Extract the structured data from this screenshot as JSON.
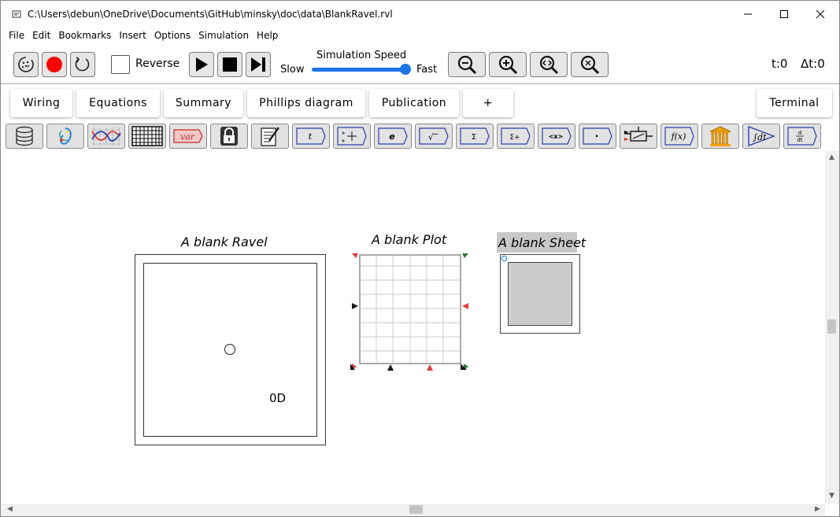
{
  "window": {
    "title": "C:\\Users\\debun\\OneDrive\\Documents\\GitHub\\minsky\\doc\\data\\BlankRavel.rvl",
    "controls": [
      "minimize-icon",
      "maximize-icon",
      "close-icon"
    ]
  },
  "menubar": {
    "items": [
      "File",
      "Edit",
      "Bookmarks",
      "Insert",
      "Options",
      "Simulation",
      "Help"
    ]
  },
  "toolbar": {
    "reverse_label": "Reverse",
    "reverse_checked": false,
    "speed_title": "Simulation Speed",
    "speed_slow": "Slow",
    "speed_fast": "Fast",
    "speed_value": 1.0,
    "t_readout": "t:0",
    "dt_readout": "Δt:0",
    "record_color": "#ff0000",
    "slider_color": "#1a73e8"
  },
  "tabs": [
    "Wiring",
    "Equations",
    "Summary",
    "Phillips diagram",
    "Publication",
    "+",
    "Terminal"
  ],
  "operators": [
    "database-icon",
    "godley-variable-icon",
    "plot-icon",
    "sheet-icon",
    "variable-icon",
    "lock-icon",
    "note-icon",
    "time-icon",
    "integrate-icon",
    "euler-icon",
    "sqrt-icon",
    "sum-icon",
    "running-sum-icon",
    "mean-icon",
    "dot-icon",
    "switch-icon",
    "user-function-icon",
    "godley-table-icon",
    "integral-icon",
    "derivative-icon"
  ],
  "operator_labels": {
    "variable": "var",
    "time": "t",
    "euler": "e",
    "sqrt": "√‾",
    "sum": "Σ",
    "running_sum": "Σ+",
    "mean": "<x>",
    "dot": "·",
    "user_function": "f(x)",
    "integral": "∫dt",
    "derivative_top": "d",
    "derivative_bottom": "dt"
  },
  "canvas": {
    "ravel": {
      "label": "A blank Ravel",
      "rank": "0D"
    },
    "plot": {
      "label": "A blank Plot"
    },
    "sheet": {
      "label": "A blank Sheet"
    }
  }
}
